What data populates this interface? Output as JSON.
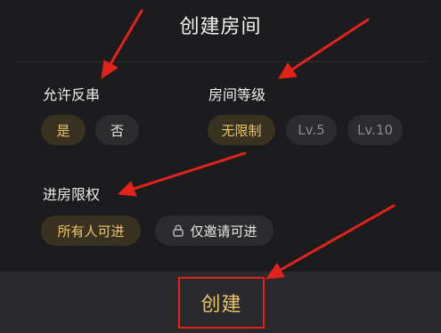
{
  "header": {
    "title": "创建房间"
  },
  "sections": {
    "allow_reverse": {
      "label": "允许反串",
      "options": [
        "是",
        "否"
      ],
      "selected": "是"
    },
    "room_level": {
      "label": "房间等级",
      "options": [
        "无限制",
        "Lv.5",
        "Lv.10"
      ],
      "selected": "无限制"
    },
    "entry_permission": {
      "label": "进房限权",
      "options": [
        "所有人可进",
        "仅邀请可进"
      ],
      "selected": "所有人可进"
    }
  },
  "footer": {
    "create_label": "创建"
  },
  "colors": {
    "accent": "#e9c46a",
    "annotation_red": "#e2231a",
    "background": "#1c1c1e"
  },
  "icons": {
    "invite_only": "lock-icon"
  }
}
